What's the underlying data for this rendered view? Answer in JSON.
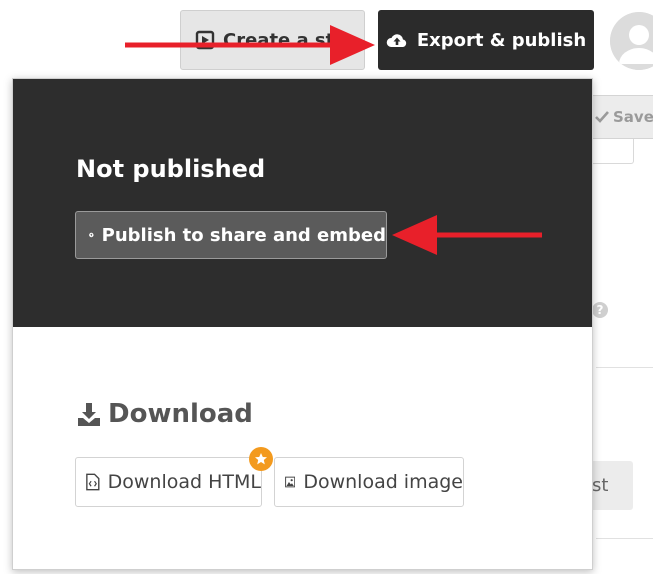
{
  "toolbar": {
    "create_label": "Create a sto",
    "export_label": "Export & publish"
  },
  "background": {
    "save_label": "Save",
    "help_glyph": "?",
    "partial_button_label": "st"
  },
  "panel": {
    "status_title": "Not published",
    "publish_button_label": "Publish to share and embed",
    "download_heading": "Download",
    "download_html_label": "Download HTML",
    "download_image_label": "Download image"
  },
  "icons": {
    "create": "play-square-icon",
    "export": "cloud-upload-icon",
    "avatar": "user-avatar-icon",
    "save": "checkmark-icon",
    "publish": "arrow-up-circle-icon",
    "download": "download-icon",
    "html_file": "code-file-icon",
    "image_file": "image-file-icon",
    "badge": "star-icon"
  },
  "colors": {
    "dark_panel": "#2d2d2d",
    "export_button": "#2b2b2b",
    "annotation_arrow": "#e8202a",
    "badge": "#f39a1e"
  }
}
